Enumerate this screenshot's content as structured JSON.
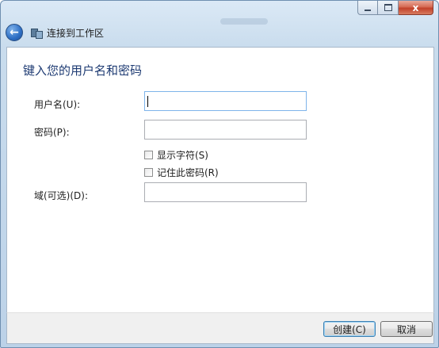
{
  "window": {
    "title": "连接到工作区",
    "close_glyph": "x"
  },
  "header": {
    "back_glyph": "←"
  },
  "main": {
    "heading": "键入您的用户名和密码",
    "username": {
      "label": "用户名(U):",
      "value": ""
    },
    "password": {
      "label": "密码(P):",
      "value": ""
    },
    "show_chars": {
      "label": "显示字符(S)",
      "checked": false
    },
    "remember": {
      "label": "记住此密码(R)",
      "checked": false
    },
    "domain": {
      "label": "域(可选)(D):",
      "value": ""
    }
  },
  "footer": {
    "create_label": "创建(C)",
    "cancel_label": "取消"
  },
  "colors": {
    "heading": "#1e3b73",
    "chrome": "#c9dced",
    "close": "#c2412a"
  },
  "icons": [
    "back-arrow-icon",
    "network-connection-icon",
    "minimize-icon",
    "maximize-icon",
    "close-icon"
  ]
}
